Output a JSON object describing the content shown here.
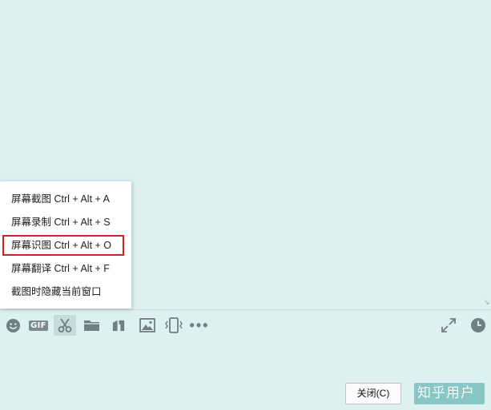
{
  "menu": {
    "items": [
      {
        "label": "屏幕截图 Ctrl + Alt + A"
      },
      {
        "label": "屏幕录制 Ctrl + Alt + S"
      },
      {
        "label": "屏幕识图 Ctrl + Alt + O",
        "highlighted": true
      },
      {
        "label": "屏幕翻译 Ctrl + Alt + F"
      },
      {
        "label": "截图时隐藏当前窗口"
      }
    ]
  },
  "toolbar": {
    "gif_label": "GIF",
    "icons": [
      "emoji-icon",
      "gif-icon",
      "scissors-icon",
      "folder-icon",
      "file-transfer-icon",
      "image-icon",
      "shake-window-icon",
      "more-icon",
      "expand-icon",
      "history-clock-icon"
    ]
  },
  "buttons": {
    "close_label": "关闭(C)"
  },
  "watermark": "知乎用户",
  "colors": {
    "background": "#dcf1f0",
    "icon": "#6f7f83",
    "highlight_border": "#d11f26",
    "send_button": "#89c7c6"
  }
}
